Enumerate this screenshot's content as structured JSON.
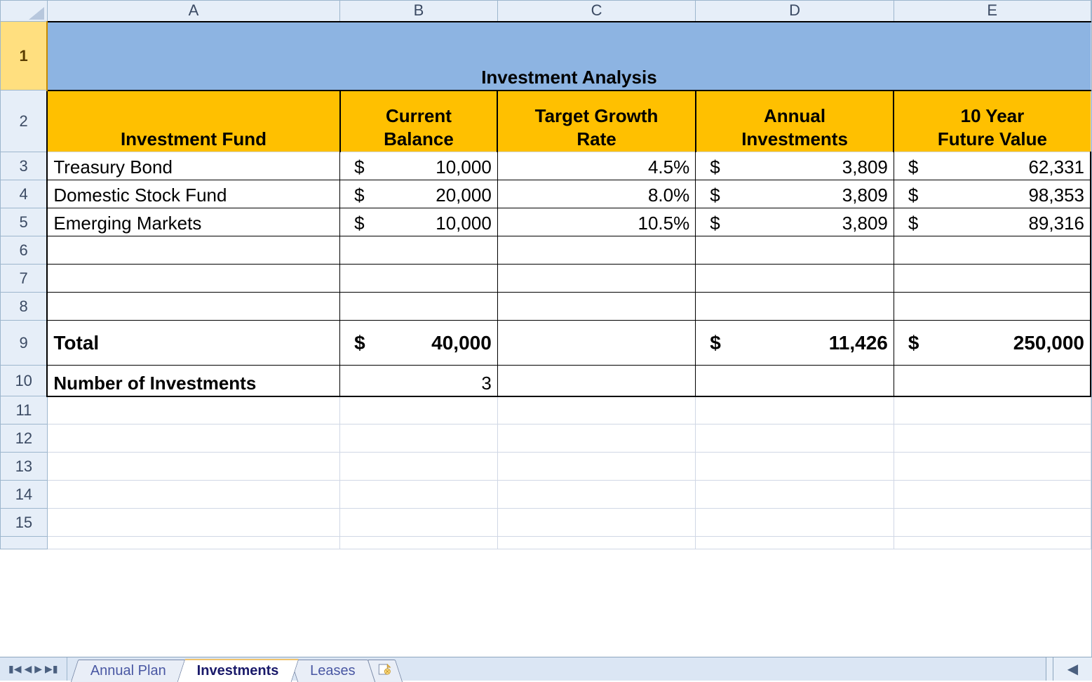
{
  "columns": [
    "A",
    "B",
    "C",
    "D",
    "E"
  ],
  "row_numbers": [
    1,
    2,
    3,
    4,
    5,
    6,
    7,
    8,
    9,
    10,
    11,
    12,
    13,
    14,
    15
  ],
  "title": "Investment Analysis",
  "headers": {
    "fund": "Investment Fund",
    "balance_l1": "Current",
    "balance_l2": "Balance",
    "rate_l1": "Target Growth",
    "rate_l2": "Rate",
    "annual_l1": "Annual",
    "annual_l2": "Investments",
    "future_l1": "10 Year",
    "future_l2": "Future Value"
  },
  "currency": "$",
  "rows": [
    {
      "fund": "Treasury Bond",
      "balance": "10,000",
      "rate": "4.5%",
      "annual": "3,809",
      "future": "62,331"
    },
    {
      "fund": "Domestic Stock Fund",
      "balance": "20,000",
      "rate": "8.0%",
      "annual": "3,809",
      "future": "98,353"
    },
    {
      "fund": "Emerging Markets",
      "balance": "10,000",
      "rate": "10.5%",
      "annual": "3,809",
      "future": "89,316"
    }
  ],
  "total": {
    "label": "Total",
    "balance": "40,000",
    "annual": "11,426",
    "future": "250,000"
  },
  "num_investments": {
    "label": "Number of Investments",
    "value": "3"
  },
  "tabs": {
    "annual_plan": "Annual Plan",
    "investments": "Investments",
    "leases": "Leases"
  },
  "chart_data": {
    "type": "table",
    "title": "Investment Analysis",
    "columns": [
      "Investment Fund",
      "Current Balance",
      "Target Growth Rate",
      "Annual Investments",
      "10 Year Future Value"
    ],
    "rows": [
      [
        "Treasury Bond",
        10000,
        0.045,
        3809,
        62331
      ],
      [
        "Domestic Stock Fund",
        20000,
        0.08,
        3809,
        98353
      ],
      [
        "Emerging Markets",
        10000,
        0.105,
        3809,
        89316
      ]
    ],
    "totals": {
      "Current Balance": 40000,
      "Annual Investments": 11426,
      "10 Year Future Value": 250000
    },
    "number_of_investments": 3
  }
}
